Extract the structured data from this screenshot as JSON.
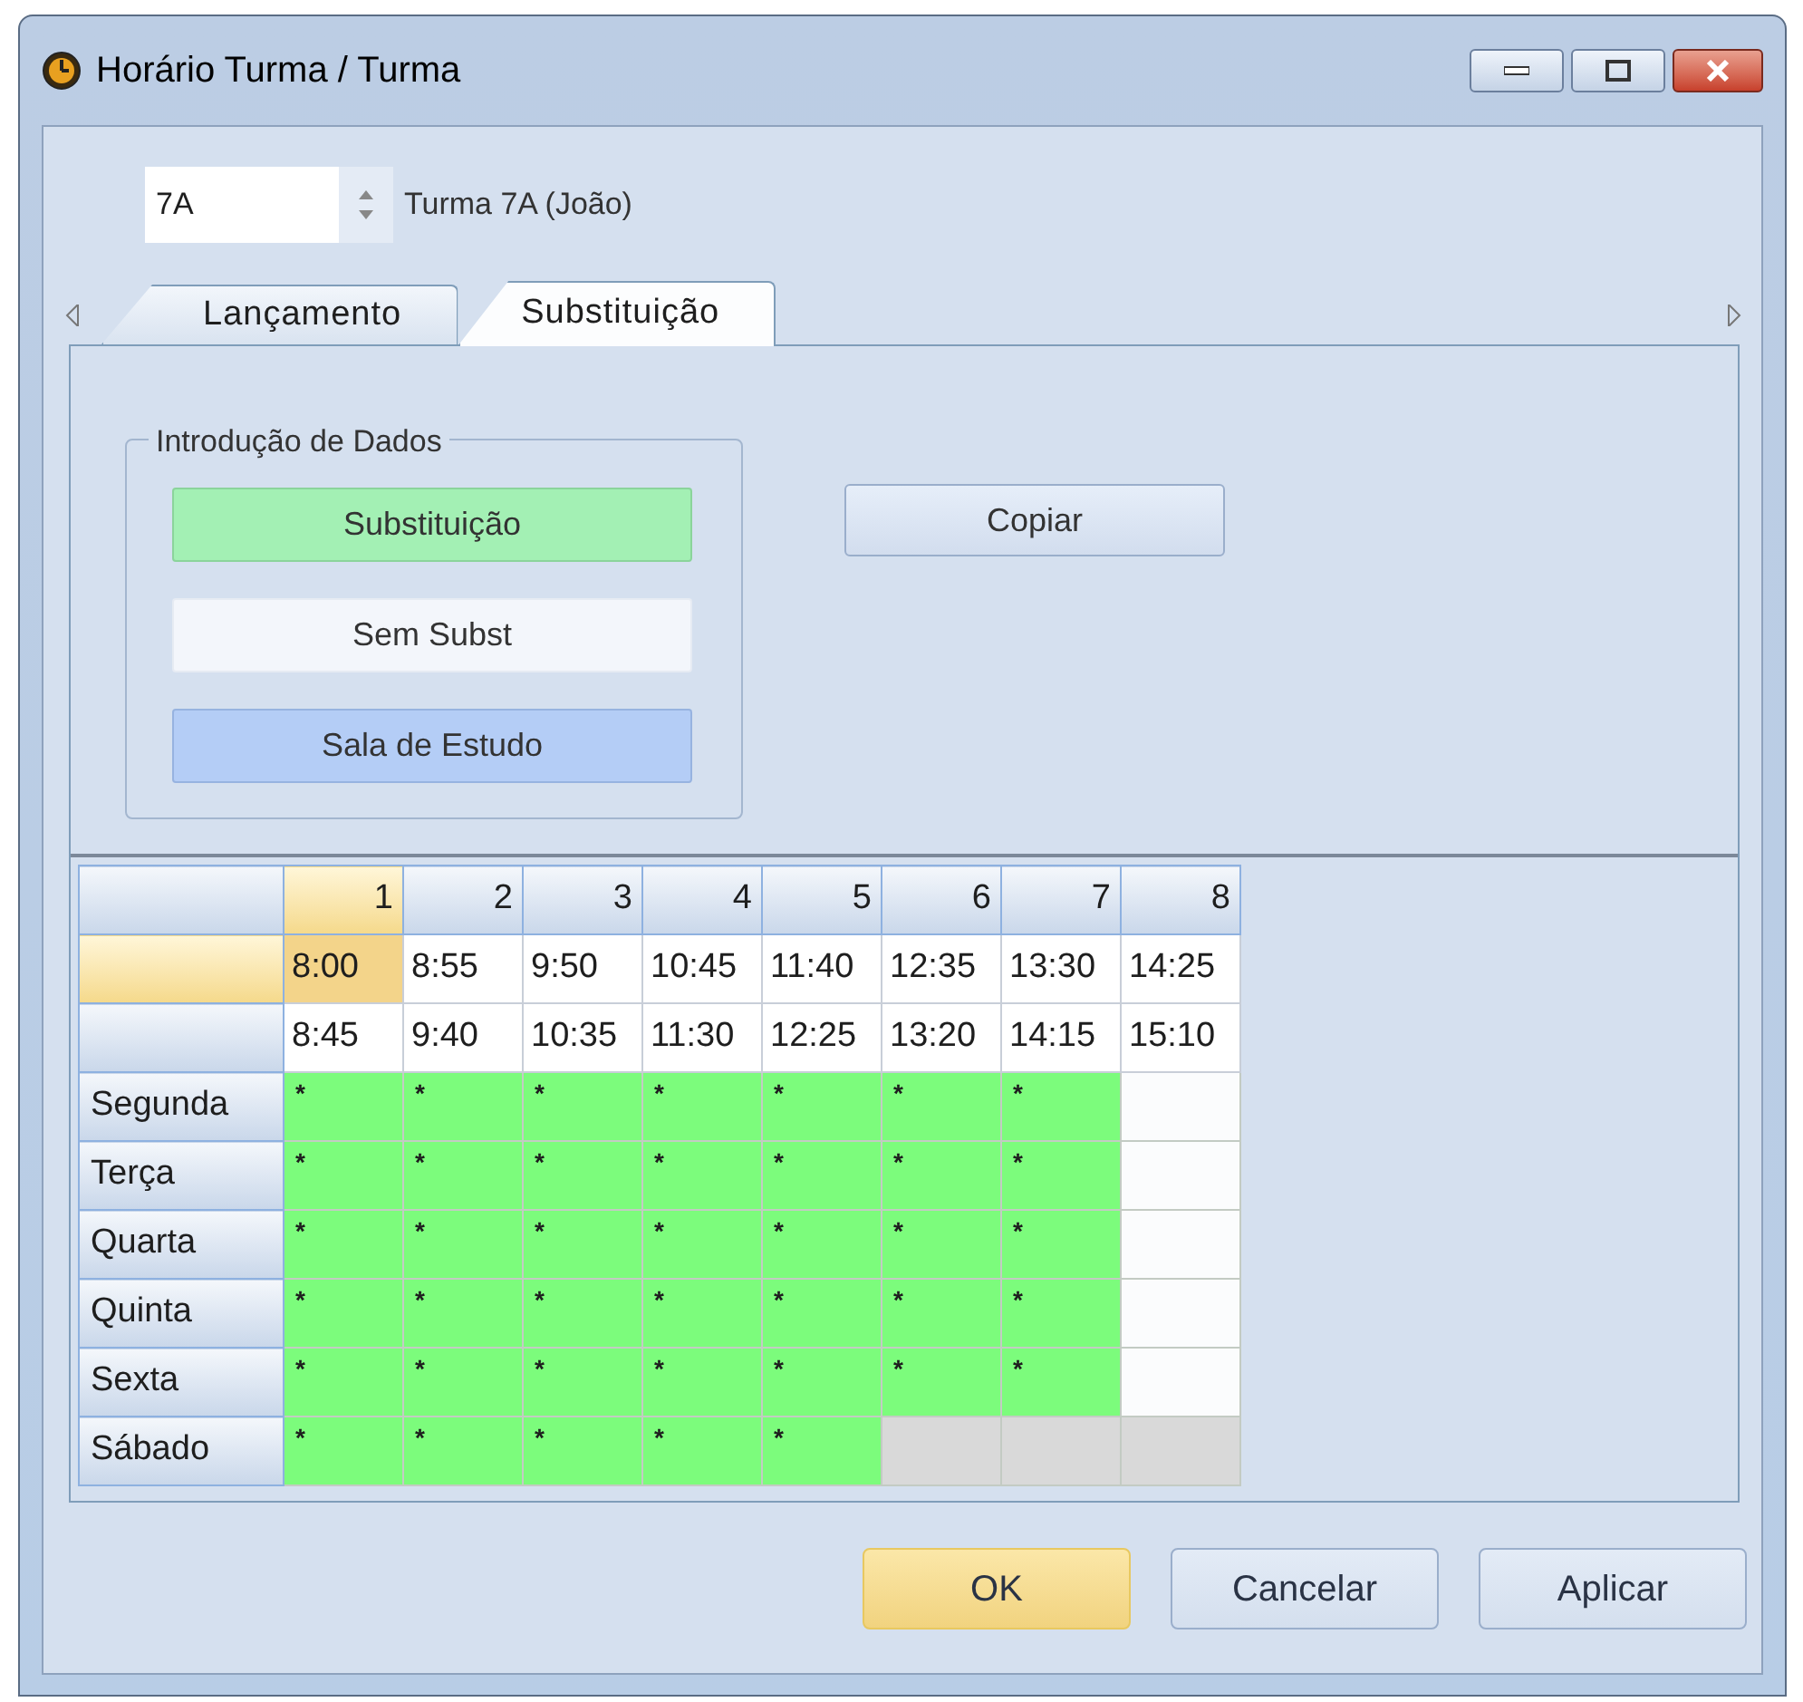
{
  "window": {
    "title": "Horário Turma / Turma"
  },
  "class_picker": {
    "value": "7A",
    "description": "Turma 7A (João)"
  },
  "tabs": [
    {
      "label": "Lançamento",
      "selected": false
    },
    {
      "label": "Substituição",
      "selected": true
    }
  ],
  "data_entry": {
    "title": "Introdução de Dados",
    "buttons": [
      {
        "label": "Substituição",
        "kind": "substitution"
      },
      {
        "label": "Sem Subst",
        "kind": "none"
      },
      {
        "label": "Sala de  Estudo",
        "kind": "study"
      }
    ]
  },
  "copy_button": "Copiar",
  "timetable": {
    "columns": [
      {
        "label": "1",
        "start": "8:00",
        "end": "8:45",
        "selected": true
      },
      {
        "label": "2",
        "start": "8:55",
        "end": "9:40",
        "selected": false
      },
      {
        "label": "3",
        "start": "9:50",
        "end": "10:35",
        "selected": false
      },
      {
        "label": "4",
        "start": "10:45",
        "end": "11:30",
        "selected": false
      },
      {
        "label": "5",
        "start": "11:40",
        "end": "12:25",
        "selected": false
      },
      {
        "label": "6",
        "start": "12:35",
        "end": "13:20",
        "selected": false
      },
      {
        "label": "7",
        "start": "13:30",
        "end": "14:15",
        "selected": false
      },
      {
        "label": "8",
        "start": "14:25",
        "end": "15:10",
        "selected": false
      }
    ],
    "rows": [
      {
        "day": "Segunda",
        "cells": [
          {
            "kind": "substitution",
            "text": "*"
          },
          {
            "kind": "substitution",
            "text": "*"
          },
          {
            "kind": "substitution",
            "text": "*"
          },
          {
            "kind": "substitution",
            "text": "*"
          },
          {
            "kind": "substitution",
            "text": "*"
          },
          {
            "kind": "substitution",
            "text": "*"
          },
          {
            "kind": "substitution",
            "text": "*"
          },
          {
            "kind": "free"
          }
        ]
      },
      {
        "day": "Terça",
        "cells": [
          {
            "kind": "substitution",
            "text": "*"
          },
          {
            "kind": "substitution",
            "text": "*"
          },
          {
            "kind": "substitution",
            "text": "*"
          },
          {
            "kind": "substitution",
            "text": "*"
          },
          {
            "kind": "substitution",
            "text": "*"
          },
          {
            "kind": "substitution",
            "text": "*"
          },
          {
            "kind": "substitution",
            "text": "*"
          },
          {
            "kind": "free"
          }
        ]
      },
      {
        "day": "Quarta",
        "cells": [
          {
            "kind": "substitution",
            "text": "*"
          },
          {
            "kind": "substitution",
            "text": "*"
          },
          {
            "kind": "substitution",
            "text": "*"
          },
          {
            "kind": "substitution",
            "text": "*"
          },
          {
            "kind": "substitution",
            "text": "*"
          },
          {
            "kind": "substitution",
            "text": "*"
          },
          {
            "kind": "substitution",
            "text": "*"
          },
          {
            "kind": "free"
          }
        ]
      },
      {
        "day": "Quinta",
        "cells": [
          {
            "kind": "substitution",
            "text": "*"
          },
          {
            "kind": "substitution",
            "text": "*"
          },
          {
            "kind": "substitution",
            "text": "*"
          },
          {
            "kind": "substitution",
            "text": "*"
          },
          {
            "kind": "substitution",
            "text": "*"
          },
          {
            "kind": "substitution",
            "text": "*"
          },
          {
            "kind": "substitution",
            "text": "*"
          },
          {
            "kind": "free"
          }
        ]
      },
      {
        "day": "Sexta",
        "cells": [
          {
            "kind": "substitution",
            "text": "*"
          },
          {
            "kind": "substitution",
            "text": "*"
          },
          {
            "kind": "substitution",
            "text": "*"
          },
          {
            "kind": "substitution",
            "text": "*"
          },
          {
            "kind": "substitution",
            "text": "*"
          },
          {
            "kind": "substitution",
            "text": "*"
          },
          {
            "kind": "substitution",
            "text": "*"
          },
          {
            "kind": "free"
          }
        ]
      },
      {
        "day": "Sábado",
        "cells": [
          {
            "kind": "substitution",
            "text": "*"
          },
          {
            "kind": "substitution",
            "text": "*"
          },
          {
            "kind": "substitution",
            "text": "*"
          },
          {
            "kind": "substitution",
            "text": "*"
          },
          {
            "kind": "substitution",
            "text": "*"
          },
          {
            "kind": "unavailable"
          },
          {
            "kind": "unavailable"
          },
          {
            "kind": "unavailable"
          }
        ]
      }
    ]
  },
  "footer_buttons": [
    {
      "label": "OK",
      "default": true
    },
    {
      "label": "Cancelar",
      "default": false
    },
    {
      "label": "Aplicar",
      "default": false
    }
  ]
}
